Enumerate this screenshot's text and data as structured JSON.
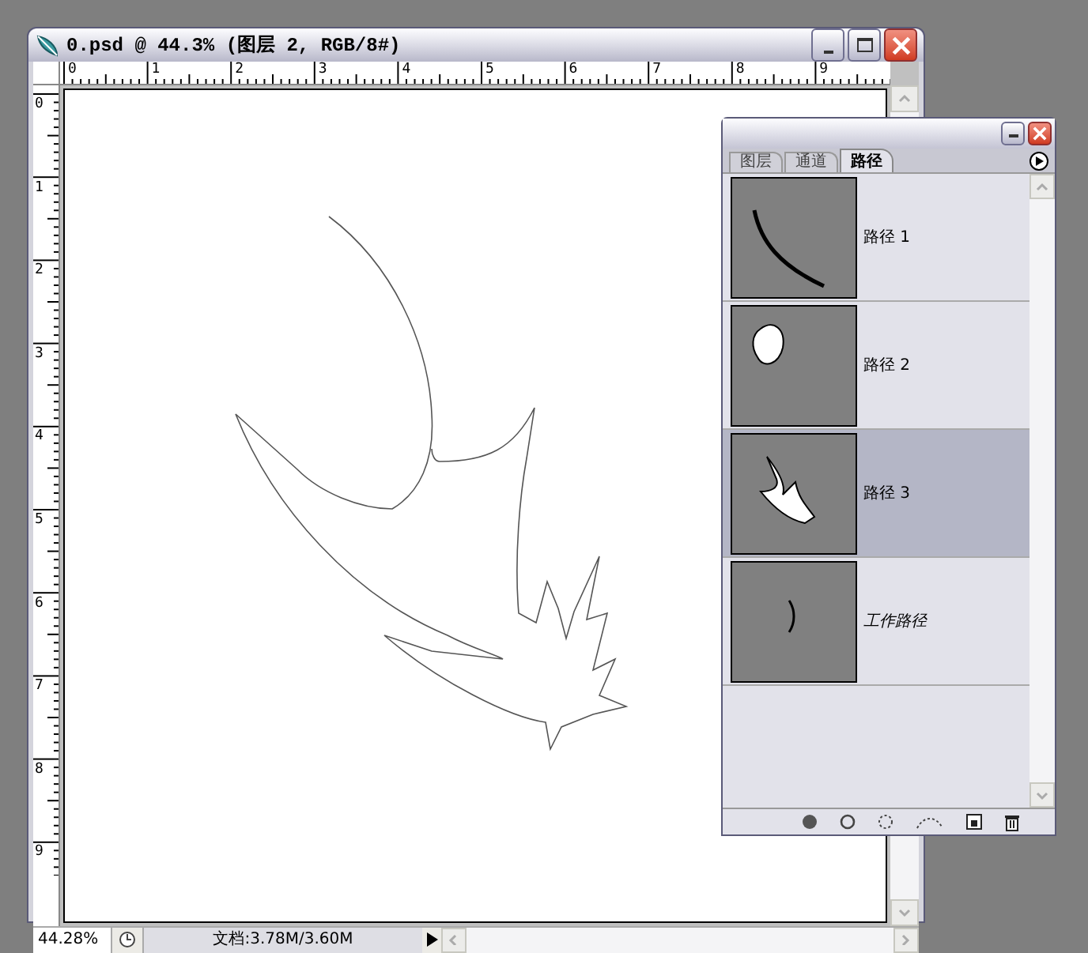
{
  "window": {
    "title": "0.psd @ 44.3% (图层 2, RGB/8#)"
  },
  "rulers": {
    "horizontal": [
      "0",
      "1",
      "2",
      "3",
      "4",
      "5",
      "6",
      "7",
      "8",
      "9"
    ],
    "vertical": [
      "0",
      "1",
      "2",
      "3",
      "4",
      "5",
      "6",
      "7",
      "8",
      "9"
    ]
  },
  "status_bar": {
    "zoom": "44.28%",
    "document_size": "文档:3.78M/3.60M"
  },
  "paths_panel": {
    "tabs": [
      {
        "label": "图层",
        "selected": false
      },
      {
        "label": "通道",
        "selected": false
      },
      {
        "label": "路径",
        "selected": true
      }
    ],
    "paths": [
      {
        "name": "路径 1",
        "kind": "saved",
        "selected": false
      },
      {
        "name": "路径 2",
        "kind": "saved",
        "selected": false
      },
      {
        "name": "路径 3",
        "kind": "saved",
        "selected": true
      },
      {
        "name": "工作路径",
        "kind": "work",
        "selected": false
      }
    ]
  }
}
